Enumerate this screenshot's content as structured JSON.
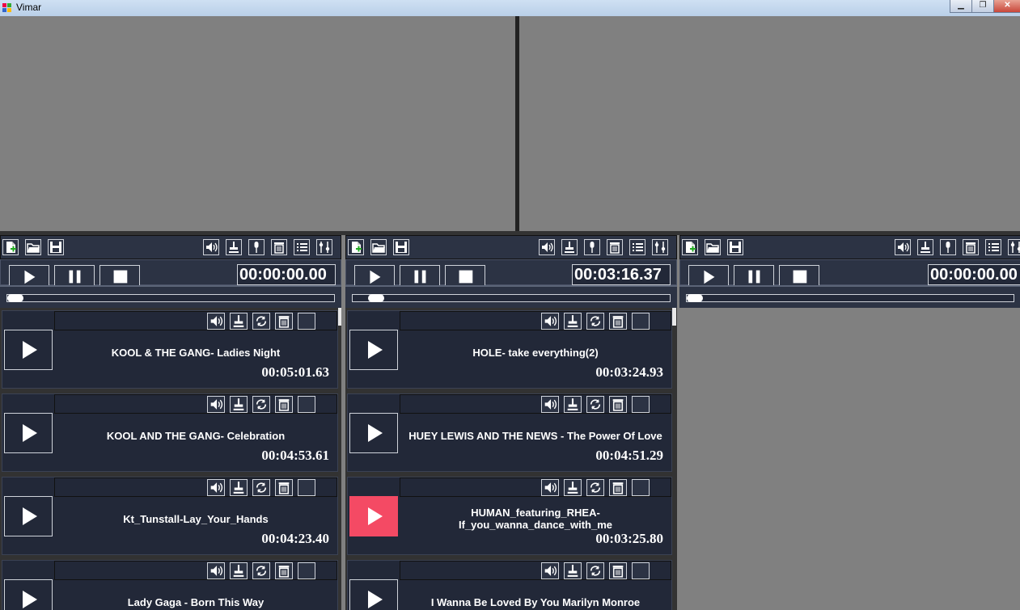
{
  "window": {
    "title": "Vimar",
    "minimize_label": "▁",
    "maximize_label": "❐",
    "close_label": "✕"
  },
  "colors": {
    "panel": "#2c3344",
    "dark": "#222838",
    "accent_playing": "#f44a64",
    "background": "#808080"
  },
  "toolbar_icons": {
    "left": [
      "new-playlist-icon",
      "open-folder-icon",
      "save-icon"
    ],
    "right": [
      "volume-icon",
      "fader-icon",
      "microphone-icon",
      "trash-icon",
      "list-icon",
      "settings-icon"
    ]
  },
  "item_toolbar_icons": [
    "volume-icon",
    "fader-icon",
    "repeat-icon",
    "trash-icon",
    "checkbox"
  ],
  "decks": [
    {
      "timer": "00:00:00.00",
      "progress": 0.0,
      "items": [
        {
          "name": "KOOL & THE GANG- Ladies Night",
          "duration": "00:05:01.63",
          "playing": false
        },
        {
          "name": "KOOL AND THE GANG- Celebration",
          "duration": "00:04:53.61",
          "playing": false
        },
        {
          "name": "Kt_Tunstall-Lay_Your_Hands",
          "duration": "00:04:23.40",
          "playing": false
        },
        {
          "name": "Lady Gaga - Born This Way",
          "duration": "",
          "playing": false
        }
      ]
    },
    {
      "timer": "00:03:16.37",
      "progress": 0.05,
      "items": [
        {
          "name": "HOLE- take everything(2)",
          "duration": "00:03:24.93",
          "playing": false
        },
        {
          "name": "HUEY LEWIS AND THE NEWS - The Power Of Love",
          "duration": "00:04:51.29",
          "playing": false
        },
        {
          "name": "HUMAN_featuring_RHEA-\nIf_you_wanna_dance_with_me",
          "duration": "00:03:25.80",
          "playing": true
        },
        {
          "name": "I Wanna Be Loved By You Marilyn Monroe",
          "duration": "",
          "playing": false
        }
      ]
    },
    {
      "timer": "00:00:00.00",
      "progress": 0.0,
      "items": []
    }
  ]
}
